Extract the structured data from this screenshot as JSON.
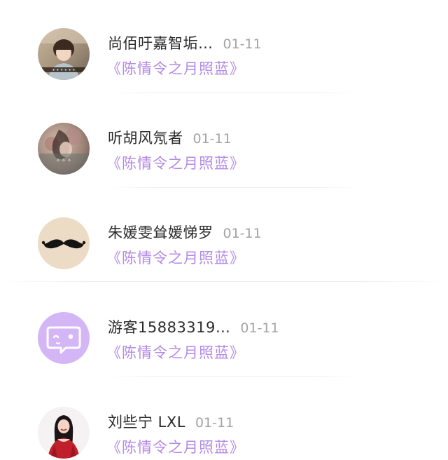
{
  "comments": [
    {
      "name": "尚佰吁嘉智垢…",
      "date": "01-11",
      "work": "《陈情令之月照蓝》",
      "avatar_icon": "girl-photo-avatar-icon"
    },
    {
      "name": "听胡风氖者",
      "date": "01-11",
      "work": "《陈情令之月照蓝》",
      "avatar_icon": "flower-girl-avatar-icon"
    },
    {
      "name": "朱媛雯耸媛悌罗",
      "date": "01-11",
      "work": "《陈情令之月照蓝》",
      "avatar_icon": "mustache-avatar-icon"
    },
    {
      "name": "游客15883319…",
      "date": "01-11",
      "work": "《陈情令之月照蓝》",
      "avatar_icon": "default-chat-avatar-icon"
    },
    {
      "name": "刘些宁 LXL",
      "date": "01-11",
      "work": "《陈情令之月照蓝》",
      "avatar_icon": "red-dress-avatar-icon"
    }
  ],
  "colors": {
    "work_title": "#b48ae6",
    "name": "#2b2b2b",
    "date": "#a3a3a3",
    "default_avatar_bg": "#d4b6f7"
  }
}
